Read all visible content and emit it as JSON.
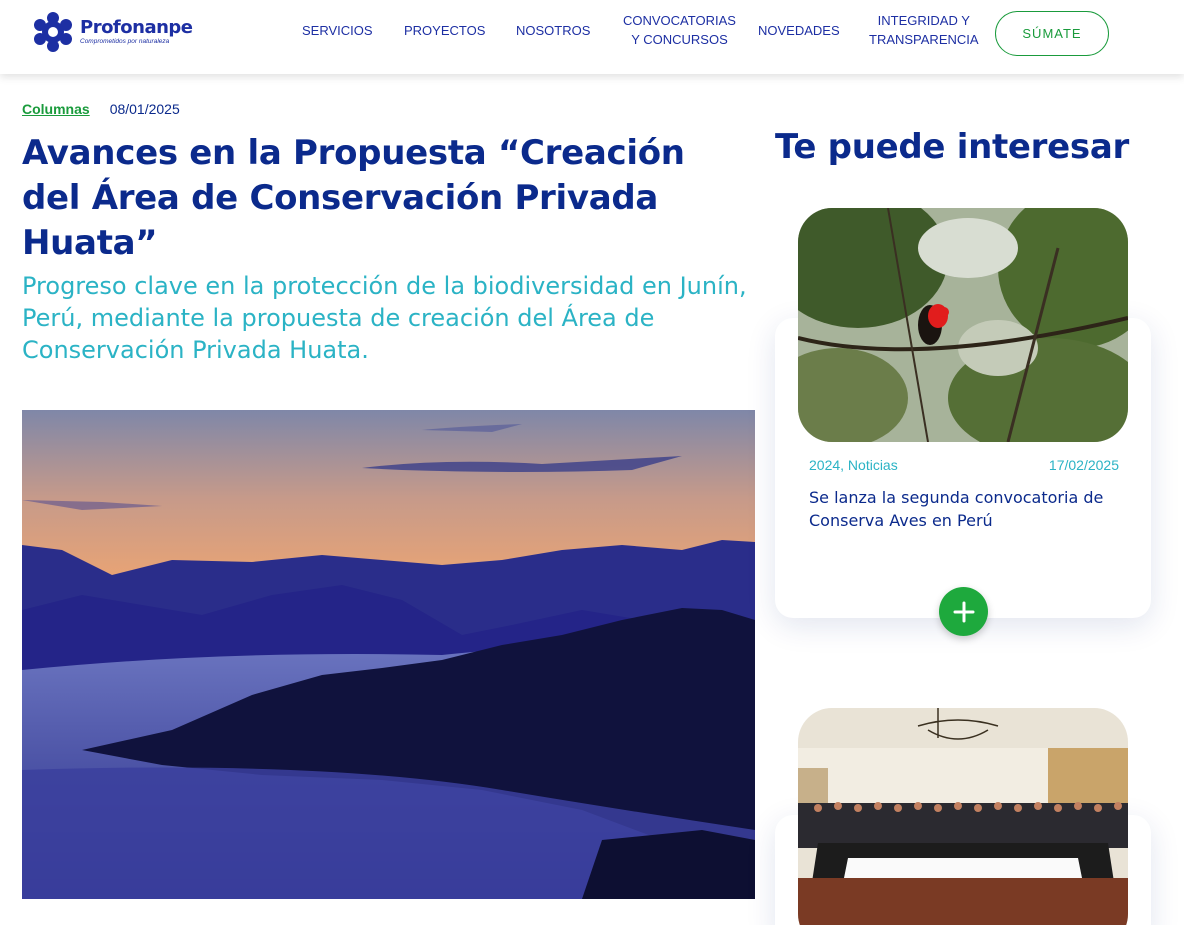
{
  "brand": {
    "name": "Profonanpe",
    "tagline": "Comprometidos por naturaleza",
    "color": "#1d2fa3"
  },
  "nav": {
    "items": [
      {
        "label": "SERVICIOS"
      },
      {
        "label": "PROYECTOS"
      },
      {
        "label": "NOSOTROS"
      },
      {
        "label": "CONVOCATORIAS\nY CONCURSOS"
      },
      {
        "label": "NOVEDADES"
      },
      {
        "label": "INTEGRIDAD Y\nTRANSPARENCIA"
      }
    ],
    "cta_label": "SÚMATE"
  },
  "article": {
    "category": "Columnas",
    "date": "08/01/2025",
    "title": "Avances en la Propuesta “Creación del Área de Conservación Privada Huata”",
    "subtitle": "Progreso clave en la protección de la biodiversidad en Junín, Perú, mediante la propuesta de creación del Área de Conservación Privada Huata."
  },
  "sidebar": {
    "title": "Te puede interesar",
    "cards": [
      {
        "category": "2024, Noticias",
        "date": "17/02/2025",
        "title": "Se lanza la segunda convocatoria de Conserva Aves en Perú",
        "image_icon": "red-bird-photo"
      },
      {
        "image_icon": "group-meeting-photo"
      }
    ]
  },
  "colors": {
    "accent_green": "#1a9b3c",
    "navy": "#0b2a8c",
    "teal": "#2bb3c5"
  }
}
